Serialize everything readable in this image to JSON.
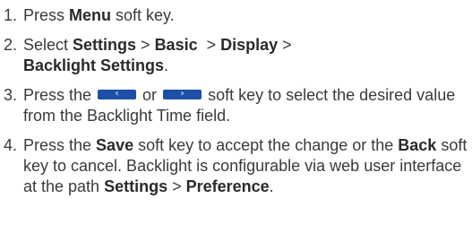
{
  "steps": [
    {
      "num": "1.",
      "parts": [
        "Press ",
        "Menu",
        " soft key."
      ]
    },
    {
      "num": "2.",
      "parts": [
        "Select ",
        "Settings",
        " > ",
        "Basic",
        "  > ",
        "Display",
        " >",
        "Backlight Settings",
        "."
      ]
    },
    {
      "num": "3.",
      "a": "Press the ",
      "b": " or ",
      "c": " soft key to select the desired value from the Backlight Time field.",
      "left_key_icon": "left-arrow-softkey-icon",
      "right_key_icon": "right-arrow-softkey-icon"
    },
    {
      "num": "4.",
      "parts": [
        "Press the ",
        "Save",
        " soft key to accept the change or the ",
        "Back",
        " soft key to cancel. Backlight is configurable via web user interface at the path ",
        "Settings",
        " > ",
        "Preference",
        "."
      ]
    }
  ],
  "colors": {
    "text": "#3a3a3a",
    "softkey": "#1e4fa8"
  }
}
